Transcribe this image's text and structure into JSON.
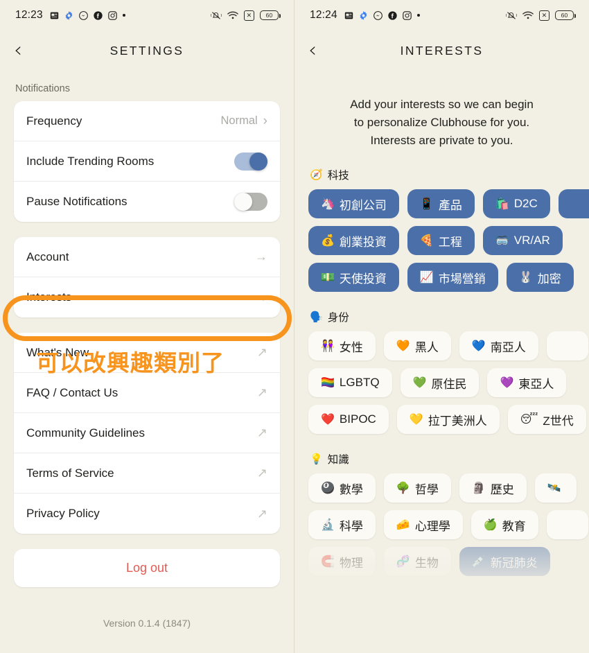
{
  "settings_screen": {
    "statusbar": {
      "time": "12:23",
      "left_icons": [
        "news-icon",
        "gear-icon",
        "messenger-icon",
        "facebook-icon",
        "instagram-icon",
        "dot-icon"
      ],
      "right_icons": [
        "vibrate-off-icon",
        "wifi-icon",
        "x-box-icon"
      ],
      "battery_level": "60"
    },
    "nav": {
      "back": "‹",
      "title": "SETTINGS"
    },
    "notifications_label": "Notifications",
    "notification_rows": [
      {
        "label": "Frequency",
        "value": "Normal",
        "control": "chevron"
      },
      {
        "label": "Include Trending Rooms",
        "value": "",
        "control": "toggle-on"
      },
      {
        "label": "Pause Notifications",
        "value": "",
        "control": "toggle-off"
      }
    ],
    "account_rows": [
      {
        "label": "Account",
        "control": "arrow-right"
      },
      {
        "label": "Interests",
        "control": "arrow-right"
      }
    ],
    "link_rows": [
      {
        "label": "What's New",
        "control": "arrow-ne"
      },
      {
        "label": "FAQ / Contact Us",
        "control": "arrow-ne"
      },
      {
        "label": "Community Guidelines",
        "control": "arrow-ne"
      },
      {
        "label": "Terms of Service",
        "control": "arrow-ne"
      },
      {
        "label": "Privacy Policy",
        "control": "arrow-ne"
      }
    ],
    "logout_label": "Log out",
    "version": "Version 0.1.4 (1847)",
    "annotation": {
      "text": "可以改興趣類別了",
      "color": "#f7941e",
      "highlight_target": "Interests"
    }
  },
  "interests_screen": {
    "statusbar": {
      "time": "12:24",
      "battery_level": "60"
    },
    "nav": {
      "back": "‹",
      "title": "INTERESTS"
    },
    "intro_lines": [
      "Add your interests so we can begin",
      "to personalize Clubhouse for you.",
      "Interests are private to you."
    ],
    "categories": [
      {
        "emoji": "🧭",
        "name": "科技",
        "rows": [
          [
            {
              "emoji": "🦄",
              "label": "初創公司",
              "selected": true
            },
            {
              "emoji": "📱",
              "label": "產品",
              "selected": true
            },
            {
              "emoji": "🛍️",
              "label": "D2C",
              "selected": true
            },
            {
              "emoji": "",
              "label": "",
              "selected": true,
              "clipped": true
            }
          ],
          [
            {
              "emoji": "💰",
              "label": "創業投資",
              "selected": true
            },
            {
              "emoji": "🍕",
              "label": "工程",
              "selected": true
            },
            {
              "emoji": "🥽",
              "label": "VR/AR",
              "selected": true
            }
          ],
          [
            {
              "emoji": "💵",
              "label": "天使投資",
              "selected": true
            },
            {
              "emoji": "📈",
              "label": "市場營銷",
              "selected": true
            },
            {
              "emoji": "🐰",
              "label": "加密",
              "selected": true
            }
          ]
        ]
      },
      {
        "emoji": "🗣️",
        "name": "身份",
        "rows": [
          [
            {
              "emoji": "👭",
              "label": "女性",
              "selected": false
            },
            {
              "emoji": "🧡",
              "label": "黑人",
              "selected": false
            },
            {
              "emoji": "💙",
              "label": "南亞人",
              "selected": false
            },
            {
              "emoji": "",
              "label": "",
              "selected": false,
              "clipped": true
            }
          ],
          [
            {
              "emoji": "🏳️‍🌈",
              "label": "LGBTQ",
              "selected": false
            },
            {
              "emoji": "💚",
              "label": "原住民",
              "selected": false
            },
            {
              "emoji": "💜",
              "label": "東亞人",
              "selected": false
            }
          ],
          [
            {
              "emoji": "❤️",
              "label": "BIPOC",
              "selected": false
            },
            {
              "emoji": "💛",
              "label": "拉丁美洲人",
              "selected": false
            },
            {
              "emoji": "😴",
              "label": "Z世代",
              "selected": false
            }
          ]
        ]
      },
      {
        "emoji": "💡",
        "name": "知識",
        "rows": [
          [
            {
              "emoji": "🎱",
              "label": "數學",
              "selected": false
            },
            {
              "emoji": "🌳",
              "label": "哲學",
              "selected": false
            },
            {
              "emoji": "🗿",
              "label": "歷史",
              "selected": false
            },
            {
              "emoji": "🛰️",
              "label": "",
              "selected": false,
              "clipped": true
            }
          ],
          [
            {
              "emoji": "🔬",
              "label": "科學",
              "selected": false
            },
            {
              "emoji": "🧀",
              "label": "心理學",
              "selected": false
            },
            {
              "emoji": "🍏",
              "label": "教育",
              "selected": false
            },
            {
              "emoji": "",
              "label": "",
              "selected": false,
              "clipped": true
            }
          ],
          [
            {
              "emoji": "🧲",
              "label": "物理",
              "selected": false
            },
            {
              "emoji": "🧬",
              "label": "生物",
              "selected": false
            },
            {
              "emoji": "💉",
              "label": "新冠肺炎",
              "selected": true
            }
          ]
        ]
      }
    ]
  },
  "colors": {
    "background": "#f2efe4",
    "card": "#ffffff",
    "chip_selected": "#4b6fa8",
    "chip_unselected": "#fbfaf5",
    "toggle_on_track": "#a9bcd9",
    "toggle_on_knob": "#4b6fa8",
    "accent_orange": "#f7941e",
    "logout_red": "#e15b53"
  }
}
